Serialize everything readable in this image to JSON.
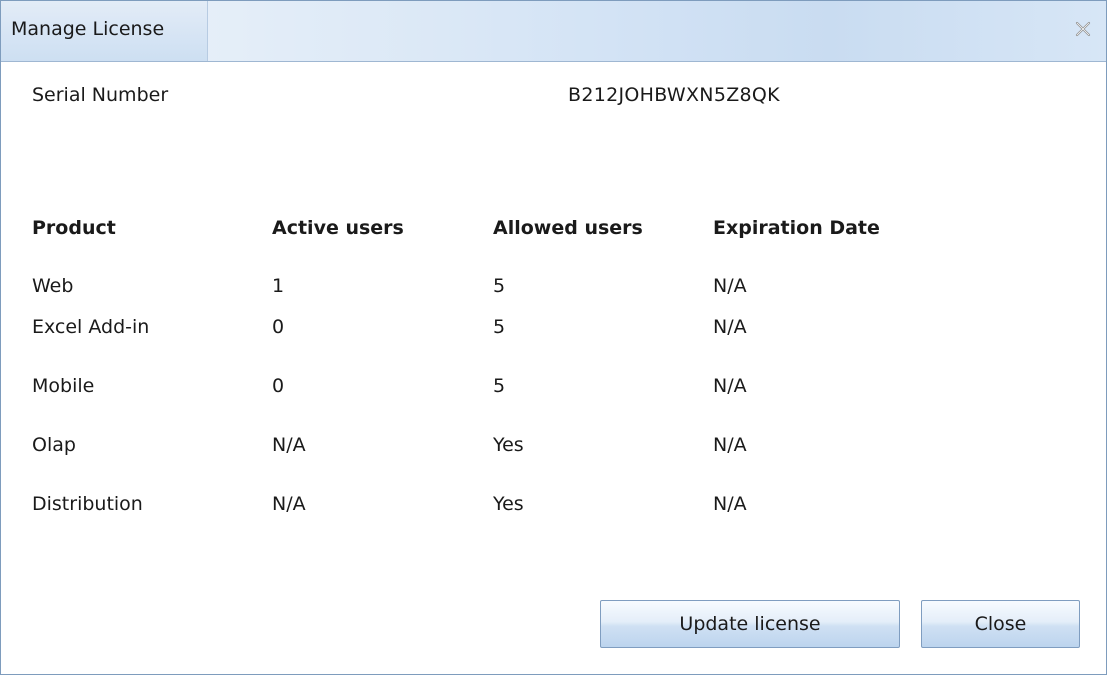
{
  "window": {
    "title": "Manage License"
  },
  "license": {
    "serial_label": "Serial Number",
    "serial_value": "B212JOHBWXN5Z8QK"
  },
  "table": {
    "headers": [
      "Product",
      "Active users",
      "Allowed users",
      "Expiration Date"
    ],
    "rows": [
      [
        "Web",
        "1",
        "5",
        "N/A"
      ],
      [
        "Excel Add-in",
        "0",
        "5",
        "N/A"
      ],
      [
        "Mobile",
        "0",
        "5",
        "N/A"
      ],
      [
        "Olap",
        "N/A",
        "Yes",
        "N/A"
      ],
      [
        "Distribution",
        "N/A",
        "Yes",
        "N/A"
      ]
    ]
  },
  "buttons": {
    "update_label": "Update license",
    "close_label": "Close"
  },
  "icons": {
    "close": "close-icon"
  },
  "colors": {
    "titlebar_accent": "#cddff2",
    "border": "#7e9cbd",
    "button_gradient_bottom": "#bcd4ee"
  }
}
